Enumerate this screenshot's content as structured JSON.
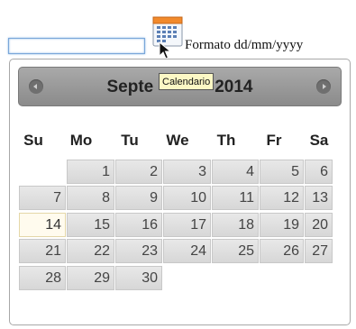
{
  "input": {
    "value": "",
    "placeholder": ""
  },
  "trigger": {
    "icon": "calendar-icon"
  },
  "format_hint": "Formato dd/mm/yyyy",
  "tooltip": "Calendario",
  "datepicker": {
    "title_left": "Septe",
    "title_right": "2014",
    "prev_icon": "prev-month-icon",
    "next_icon": "next-month-icon",
    "weekdays": [
      "Su",
      "Mo",
      "Tu",
      "We",
      "Th",
      "Fr",
      "Sa"
    ],
    "weeks": [
      [
        "",
        "1",
        "2",
        "3",
        "4",
        "5",
        "6"
      ],
      [
        "7",
        "8",
        "9",
        "10",
        "11",
        "12",
        "13"
      ],
      [
        "14",
        "15",
        "16",
        "17",
        "18",
        "19",
        "20"
      ],
      [
        "21",
        "22",
        "23",
        "24",
        "25",
        "26",
        "27"
      ],
      [
        "28",
        "29",
        "30",
        "",
        "",
        "",
        ""
      ]
    ],
    "highlighted_day": "14"
  },
  "colors": {
    "header_top": "#a9a9a9",
    "header_bottom": "#8b8b8b",
    "day_cell": "#dedede",
    "today_cell": "#fffbee",
    "tooltip_bg": "#fcf8c5"
  }
}
